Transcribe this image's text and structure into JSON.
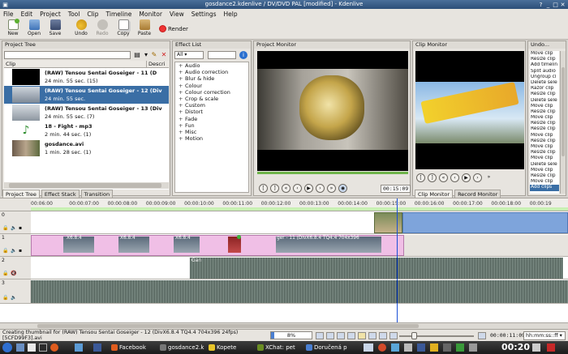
{
  "window": {
    "title": "gosdance2.kdenlive / DV/DVD PAL [modified] - Kdenlive"
  },
  "menu": [
    "File",
    "Edit",
    "Project",
    "Tool",
    "Clip",
    "Timeline",
    "Monitor",
    "View",
    "Settings",
    "Help"
  ],
  "toolbar": {
    "new": "New",
    "open": "Open",
    "save": "Save",
    "undo": "Undo",
    "redo": "Redo",
    "copy": "Copy",
    "paste": "Paste",
    "render": "Render"
  },
  "project_tree": {
    "title": "Project Tree",
    "col_clip": "Clip",
    "col_desc": "Descri",
    "clips": [
      {
        "name": "(RAW) Tensou Sentai Goseiger - 11 (D",
        "info": "24 min. 55 sec. (15)"
      },
      {
        "name": "(RAW) Tensou Sentai Goseiger - 12 (Div",
        "info": "24 min. 55 sec."
      },
      {
        "name": "(RAW) Tensou Sentai Goseiger - 13 (Div",
        "info": "24 min. 55 sec. (7)"
      },
      {
        "name": "18 - Fight - mp3",
        "info": "2 min. 44 sec. (1)"
      },
      {
        "name": "gosdance.avi",
        "info": "1 min. 28 sec. (1)"
      }
    ],
    "tabs": [
      "Project Tree",
      "Effect Stack",
      "Transition"
    ]
  },
  "effect_list": {
    "title": "Effect List",
    "filter": "All",
    "items": [
      "Audio",
      "Audio correction",
      "Blur & hide",
      "Colour",
      "Colour correction",
      "Crop & scale",
      "Custom",
      "Distort",
      "Fade",
      "Fun",
      "Misc",
      "Motion"
    ]
  },
  "project_monitor": {
    "title": "Project Monitor",
    "timecode": "00:15:09"
  },
  "clip_monitor": {
    "title": "Clip Monitor",
    "tabs": [
      "Clip Monitor",
      "Record Monitor"
    ]
  },
  "undo": {
    "title": "Undo...",
    "items": [
      "Move clip",
      "Resize clip",
      "Add timelin",
      "Split audio",
      "Ungroup cl",
      "Delete sele",
      "Razor clip",
      "Resize clip",
      "Delete sele",
      "Move clip",
      "Resize clip",
      "Move clip",
      "Resize clip",
      "Resize clip",
      "Move clip",
      "Resize clip",
      "Move clip",
      "Resize clip",
      "Move clip",
      "Delete sele",
      "Move clip",
      "Resize clip",
      "Move clip",
      "Add clips"
    ]
  },
  "timeline": {
    "ticks": [
      "00:06:00",
      "00:00:07:00",
      "00:00:08:00",
      "00:00:09:00",
      "00:00:10:00",
      "00:00:11:00",
      "00:00:12:00",
      "00:00:13:00",
      "00:00:14:00",
      "00:00:15:00",
      "00:00:16:00",
      "00:00:17:00",
      "00:00:18:00",
      "00:00:19"
    ],
    "tracks": [
      "0",
      "1",
      "2",
      "3"
    ],
    "clip_labels": [
      "X6.8.4",
      "X6.8.4",
      "X6.8.4",
      "X6.8.4",
      "X6.8.4",
      "X6.8.4",
      "Xv...",
      "ger - 11 (DivX6.8.4 TQ4.4 704x396"
    ],
    "audio_labels": [
      "Gan"
    ]
  },
  "status": {
    "message": "Creating thumbnail for (RAW) Tensou Sentai Goseiger - 12 (DivX6.8.4 TQ4.4 704x396 24fps) [5CFD99F3].avi",
    "progress_pct": 8,
    "progress_label": "8%",
    "timecode": "00:00:11:09",
    "format": "hh:mm:ss::ff"
  },
  "taskbar": {
    "tasks": [
      "Facebook",
      "gosdance2.k",
      "Kopete",
      "XChat: pet",
      "Doručená p"
    ],
    "clock": "00:20"
  },
  "colors": {
    "accent": "#3a6ea5",
    "video_clip": "#f0bfe6",
    "playhead": "#1a4fd6"
  }
}
